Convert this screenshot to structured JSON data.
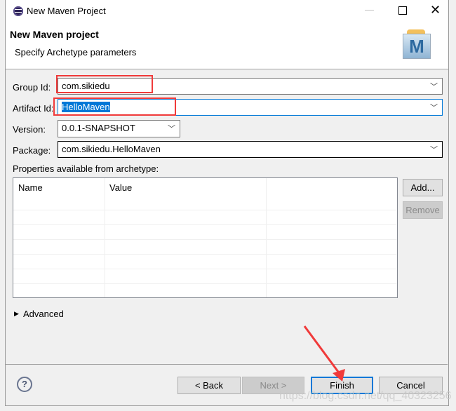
{
  "window": {
    "title": "New Maven Project"
  },
  "header": {
    "title": "New Maven project",
    "subtitle": "Specify Archetype parameters",
    "logo_letter": "M"
  },
  "form": {
    "group_id": {
      "label": "Group Id:",
      "value": "com.sikiedu"
    },
    "artifact_id": {
      "label": "Artifact Id:",
      "value": "HelloMaven"
    },
    "version": {
      "label": "Version:",
      "value": "0.0.1-SNAPSHOT"
    },
    "package": {
      "label": "Package:",
      "value": "com.sikiedu.HelloMaven"
    }
  },
  "properties": {
    "label": "Properties available from archetype:",
    "columns": [
      "Name",
      "Value"
    ],
    "add": "Add...",
    "remove": "Remove"
  },
  "advanced": "Advanced",
  "buttons": {
    "back": "< Back",
    "next": "Next >",
    "finish": "Finish",
    "cancel": "Cancel"
  },
  "watermark": "https://blog.csdn.net/qq_40323256",
  "colors": {
    "highlight": "#f03a3a",
    "selection": "#0078d7"
  }
}
